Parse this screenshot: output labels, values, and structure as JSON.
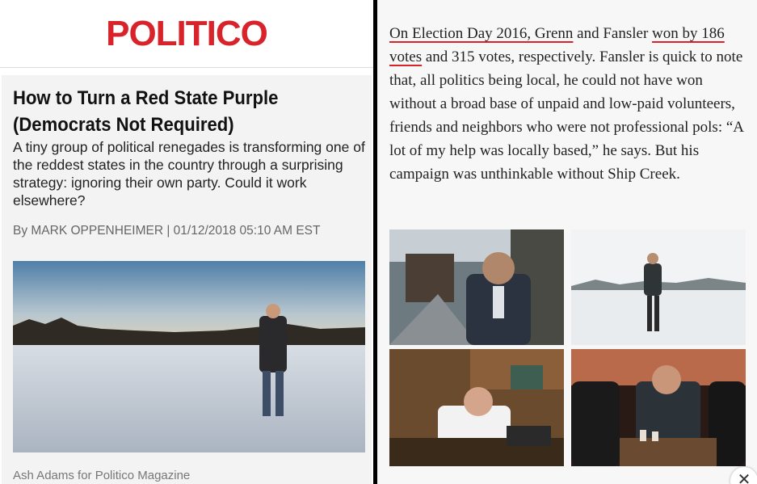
{
  "left": {
    "logo": "POLITICO",
    "headline": "How to Turn a Red State Purple (Democrats Not Required)",
    "dek": "A tiny group of political renegades is transforming one of the reddest states in the country through a surprising strategy: ignoring their own party. Could it work elsewhere?",
    "byline": "By MARK OPPENHEIMER | 01/12/2018 05:10 AM EST",
    "caption": "Ash Adams for Politico Magazine"
  },
  "right": {
    "para_u1": "On Election Day 2016, Grenn",
    "para_t1": " and Fansler ",
    "para_u2": "won by 186 votes",
    "para_t2": " and 315 votes, respectively. Fansler is quick to note that, all politics being local, he could not have won without a broad base of unpaid and low-paid volunteers, friends and neighbors who were not professional pols: “A lot of my help was locally based,” he says. But his campaign was unthinkable without Ship Creek.",
    "close_glyph": "✕"
  },
  "colors": {
    "accent": "#d8232a"
  },
  "icons": {
    "close": "close-icon"
  }
}
